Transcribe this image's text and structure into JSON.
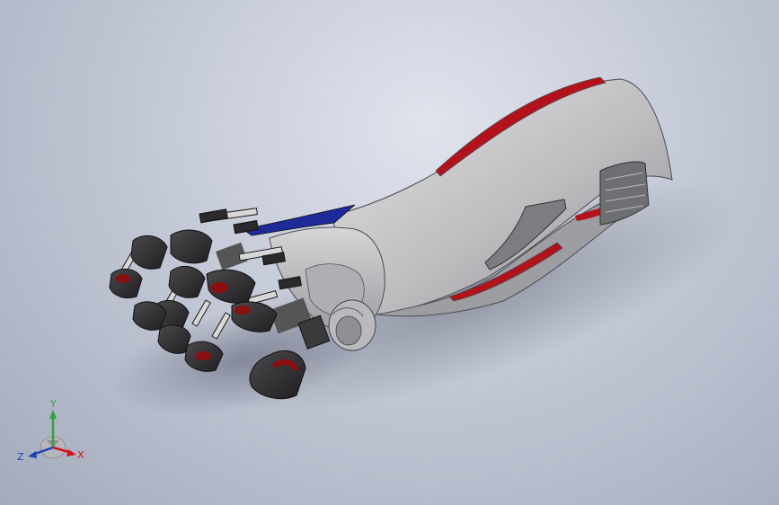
{
  "viewport": {
    "background_top": "#dfe3ec",
    "background_bottom": "#a4abbc"
  },
  "model": {
    "description_icon": "prosthetic-hand-model-icon",
    "colors": {
      "shell": "#c9c9cb",
      "shell_shadow": "#8e8f93",
      "accent_red": "#b3121b",
      "accent_blue": "#1e2a9a",
      "finger_dark": "#2c2c2e",
      "joint_red": "#8a0f10",
      "link_silver": "#d8d8d8"
    }
  },
  "triad": {
    "y_label": "Y",
    "x_label": "X",
    "z_label": "Z",
    "colors": {
      "x": "#d2141a",
      "y": "#2fa53a",
      "z": "#1d3fb8"
    }
  }
}
